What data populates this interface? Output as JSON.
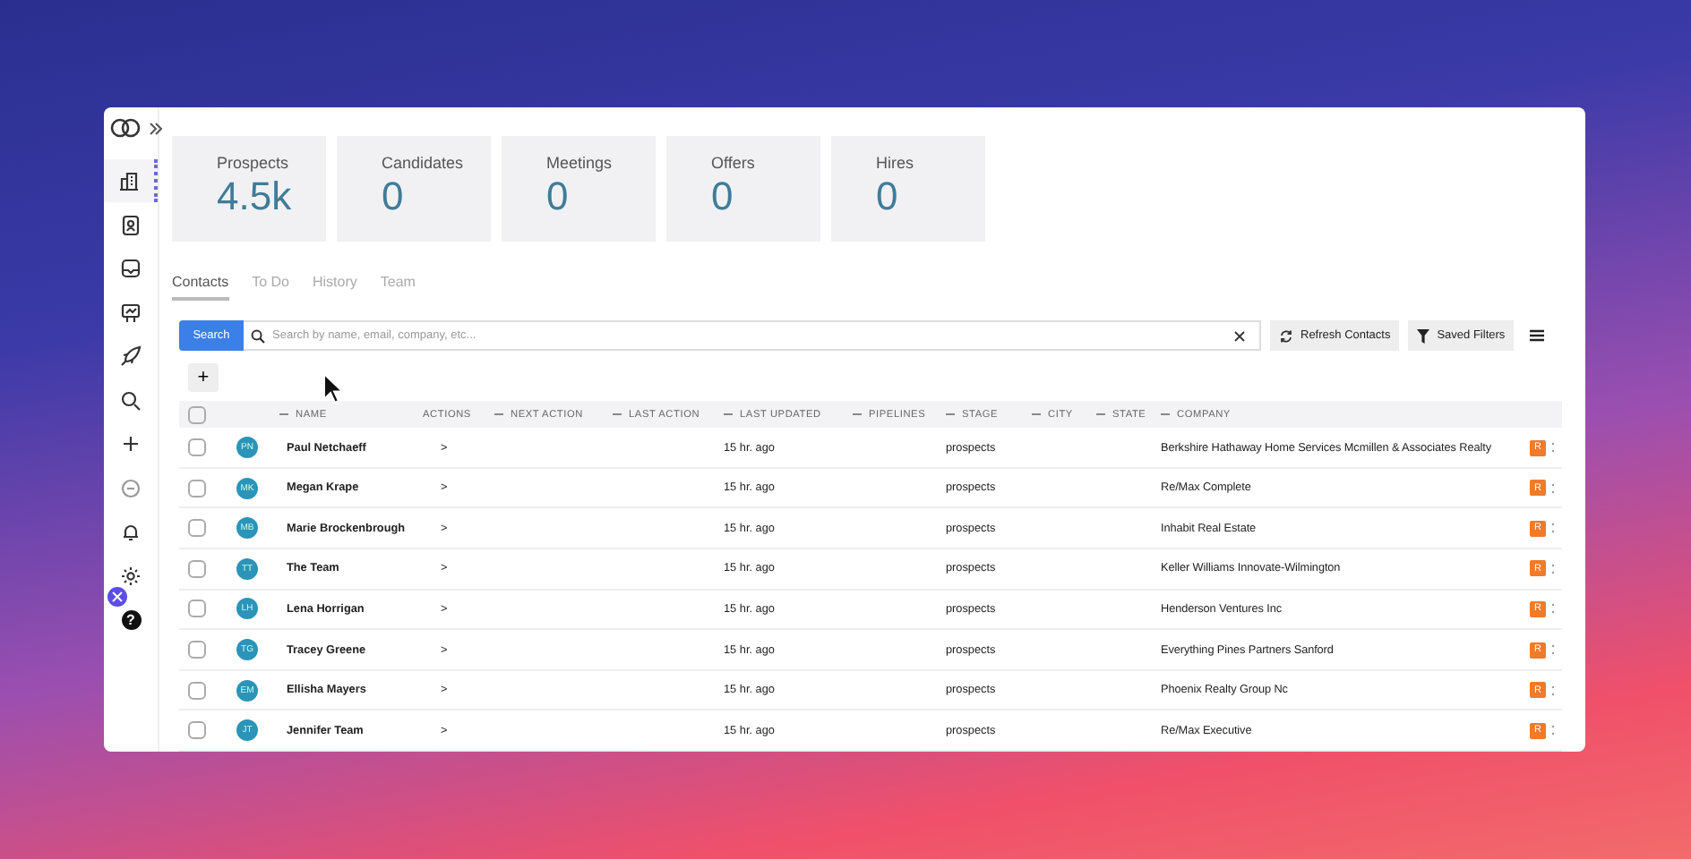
{
  "sidebar": {
    "items": [
      {
        "kind": "building",
        "selected": true
      },
      {
        "kind": "contact",
        "selected": false
      },
      {
        "kind": "inbox",
        "selected": false
      },
      {
        "kind": "board",
        "selected": false
      },
      {
        "kind": "rocket",
        "selected": false
      },
      {
        "kind": "search",
        "selected": false
      },
      {
        "kind": "plus",
        "selected": false
      },
      {
        "kind": "chat",
        "selected": false
      },
      {
        "kind": "bell",
        "selected": false
      },
      {
        "kind": "gear",
        "selected": false
      }
    ],
    "help": "?"
  },
  "stats": [
    {
      "label": "Prospects",
      "value": "4.5k"
    },
    {
      "label": "Candidates",
      "value": "0"
    },
    {
      "label": "Meetings",
      "value": "0"
    },
    {
      "label": "Offers",
      "value": "0"
    },
    {
      "label": "Hires",
      "value": "0"
    }
  ],
  "tabs": [
    {
      "label": "Contacts",
      "selected": true
    },
    {
      "label": "To Do",
      "selected": false
    },
    {
      "label": "History",
      "selected": false
    },
    {
      "label": "Team",
      "selected": false
    }
  ],
  "search": {
    "button": "Search",
    "placeholder": "Search by name, email, company, etc..."
  },
  "toolbar": {
    "refresh": "Refresh Contacts",
    "filters": "Saved Filters"
  },
  "add_button": "+",
  "table": {
    "all_checked": false,
    "columns": [
      {
        "label": "NAME",
        "kind": "draggable"
      },
      {
        "label": "ACTIONS",
        "kind": "fixed"
      },
      {
        "label": "NEXT ACTION",
        "kind": "draggable"
      },
      {
        "label": "LAST ACTION",
        "kind": "draggable"
      },
      {
        "label": "LAST UPDATED",
        "kind": "draggable"
      },
      {
        "label": "PIPELINES",
        "kind": "draggable"
      },
      {
        "label": "STAGE",
        "kind": "draggable"
      },
      {
        "label": "CITY",
        "kind": "draggable"
      },
      {
        "label": "STATE",
        "kind": "draggable"
      },
      {
        "label": "COMPANY",
        "kind": "draggable"
      }
    ],
    "rows": [
      {
        "checked": false,
        "initials": "PN",
        "name": "Paul Netchaeff",
        "actions": ">",
        "updated": "15 hr. ago",
        "stage": "prospects",
        "company": "Berkshire Hathaway Home Services Mcmillen & Associates Realty",
        "badge": "R"
      },
      {
        "checked": false,
        "initials": "MK",
        "name": "Megan Krape",
        "actions": ">",
        "updated": "15 hr. ago",
        "stage": "prospects",
        "company": "Re/Max Complete",
        "badge": "R"
      },
      {
        "checked": false,
        "initials": "MB",
        "name": "Marie Brockenbrough",
        "actions": ">",
        "updated": "15 hr. ago",
        "stage": "prospects",
        "company": "Inhabit Real Estate",
        "badge": "R"
      },
      {
        "checked": false,
        "initials": "TT",
        "name": "The Team",
        "actions": ">",
        "updated": "15 hr. ago",
        "stage": "prospects",
        "company": "Keller Williams Innovate-Wilmington",
        "badge": "R"
      },
      {
        "checked": false,
        "initials": "LH",
        "name": "Lena Horrigan",
        "actions": ">",
        "updated": "15 hr. ago",
        "stage": "prospects",
        "company": "Henderson Ventures Inc",
        "badge": "R"
      },
      {
        "checked": false,
        "initials": "TG",
        "name": "Tracey Greene",
        "actions": ">",
        "updated": "15 hr. ago",
        "stage": "prospects",
        "company": "Everything Pines Partners Sanford",
        "badge": "R"
      },
      {
        "checked": false,
        "initials": "EM",
        "name": "Ellisha Mayers",
        "actions": ">",
        "updated": "15 hr. ago",
        "stage": "prospects",
        "company": "Phoenix Realty Group Nc",
        "badge": "R"
      },
      {
        "checked": false,
        "initials": "JT",
        "name": "Jennifer Team",
        "actions": ">",
        "updated": "15 hr. ago",
        "stage": "prospects",
        "company": "Re/Max Executive",
        "badge": "R"
      }
    ]
  }
}
